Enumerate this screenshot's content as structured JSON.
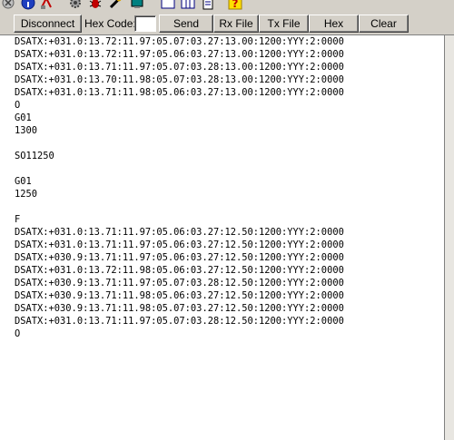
{
  "toolbar": {
    "icons": [
      "close-icon",
      "info-icon",
      "connect-icon",
      "settings-icon",
      "bug-icon",
      "wrench-icon",
      "terminal-icon",
      "window-icon",
      "panel-icon",
      "document-icon",
      "help-icon"
    ],
    "disconnect_label": "Disconnect",
    "hex_code_label": "Hex Code:",
    "hex_code_value": "",
    "send_label": "Send",
    "rx_file_label": "Rx File",
    "tx_file_label": "Tx File",
    "hex_label": "Hex",
    "clear_label": "Clear"
  },
  "terminal": {
    "lines": [
      "DSATX:+031.0:13.72:11.97:05.07:03.27:13.00:1200:YYY:2:0000",
      "DSATX:+031.0:13.72:11.97:05.06:03.27:13.00:1200:YYY:2:0000",
      "DSATX:+031.0:13.71:11.97:05.07:03.28:13.00:1200:YYY:2:0000",
      "DSATX:+031.0:13.70:11.98:05.07:03.28:13.00:1200:YYY:2:0000",
      "DSATX:+031.0:13.71:11.98:05.06:03.27:13.00:1200:YYY:2:0000",
      "O",
      "G01",
      "1300",
      "",
      "SO11250",
      "",
      "G01",
      "1250",
      "",
      "F",
      "DSATX:+031.0:13.71:11.97:05.06:03.27:12.50:1200:YYY:2:0000",
      "DSATX:+031.0:13.71:11.97:05.06:03.27:12.50:1200:YYY:2:0000",
      "DSATX:+030.9:13.71:11.97:05.06:03.27:12.50:1200:YYY:2:0000",
      "DSATX:+031.0:13.72:11.98:05.06:03.27:12.50:1200:YYY:2:0000",
      "DSATX:+030.9:13.71:11.97:05.07:03.28:12.50:1200:YYY:2:0000",
      "DSATX:+030.9:13.71:11.98:05.06:03.27:12.50:1200:YYY:2:0000",
      "DSATX:+030.9:13.71:11.98:05.07:03.27:12.50:1200:YYY:2:0000",
      "DSATX:+031.0:13.71:11.97:05.07:03.28:12.50:1200:YYY:2:0000",
      "O"
    ]
  }
}
